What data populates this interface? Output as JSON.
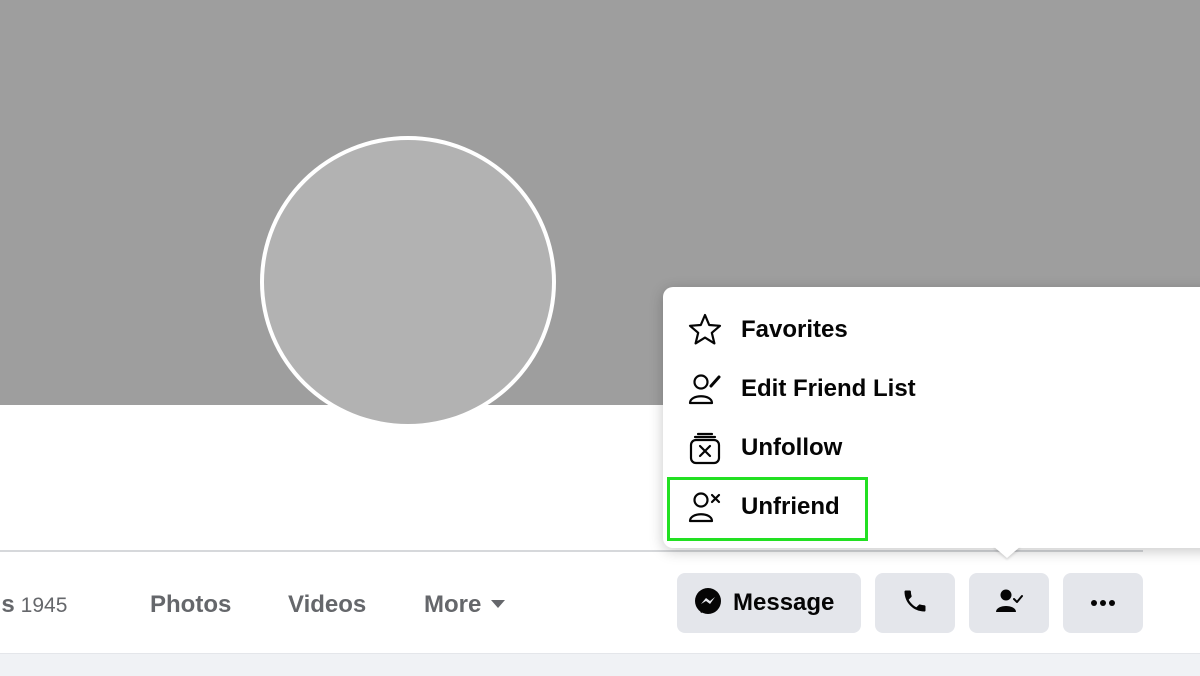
{
  "profile": {
    "cover": "cover-photo",
    "avatar": "profile-picture"
  },
  "tabs": {
    "friends": {
      "label": "nds",
      "count": "1945"
    },
    "photos": "Photos",
    "videos": "Videos",
    "more": "More"
  },
  "actions": {
    "message_label": "Message",
    "message_icon": "messenger-icon",
    "call_icon": "phone-icon",
    "friends_icon": "friends-check-icon",
    "more_icon": "ellipsis-icon"
  },
  "menu": {
    "items": [
      {
        "label": "Favorites",
        "icon": "star-icon"
      },
      {
        "label": "Edit Friend List",
        "icon": "person-edit-icon"
      },
      {
        "label": "Unfollow",
        "icon": "unfollow-icon"
      },
      {
        "label": "Unfriend",
        "icon": "person-remove-icon"
      }
    ],
    "highlighted_item": "Unfriend"
  },
  "colors": {
    "highlight": "#22e022",
    "button_bg": "#e4e6eb",
    "cover": "#9e9e9e"
  }
}
